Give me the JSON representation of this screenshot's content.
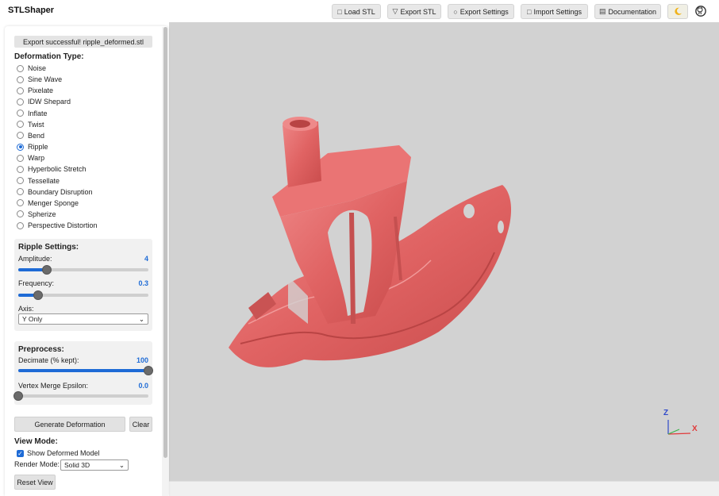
{
  "app": {
    "title": "STLShaper"
  },
  "toolbar": {
    "load_stl": "Load STL",
    "export_stl": "Export STL",
    "export_settings": "Export Settings",
    "import_settings": "Import Settings",
    "documentation": "Documentation",
    "theme_icon": "moon-icon",
    "github_icon": "github-icon"
  },
  "status": {
    "message": "Export successful! ripple_deformed.stl"
  },
  "deformation": {
    "heading": "Deformation Type:",
    "selected": "Ripple",
    "options": [
      "Noise",
      "Sine Wave",
      "Pixelate",
      "IDW Shepard",
      "Inflate",
      "Twist",
      "Bend",
      "Ripple",
      "Warp",
      "Hyperbolic Stretch",
      "Tessellate",
      "Boundary Disruption",
      "Menger Sponge",
      "Spherize",
      "Perspective Distortion"
    ]
  },
  "ripple": {
    "heading": "Ripple Settings:",
    "amplitude_label": "Amplitude:",
    "amplitude_value": "4",
    "amplitude_fraction": 0.22,
    "frequency_label": "Frequency:",
    "frequency_value": "0.3",
    "frequency_fraction": 0.15,
    "axis_label": "Axis:",
    "axis_value": "Y Only"
  },
  "preprocess": {
    "heading": "Preprocess:",
    "decimate_label": "Decimate (% kept):",
    "decimate_value": "100",
    "decimate_fraction": 1.0,
    "epsilon_label": "Vertex Merge Epsilon:",
    "epsilon_value": "0.0",
    "epsilon_fraction": 0.0
  },
  "actions": {
    "generate": "Generate Deformation",
    "clear": "Clear"
  },
  "view_mode": {
    "heading": "View Mode:",
    "show_deformed_label": "Show Deformed Model",
    "show_deformed_checked": true,
    "render_mode_label": "Render Mode:",
    "render_mode_value": "Solid 3D",
    "reset_view": "Reset View"
  },
  "axes_gizmo": {
    "z_label": "Z",
    "x_label": "X"
  },
  "colors": {
    "model": "#e26566",
    "accent": "#1e6bd6",
    "viewport_bg": "#d2d2d2"
  }
}
